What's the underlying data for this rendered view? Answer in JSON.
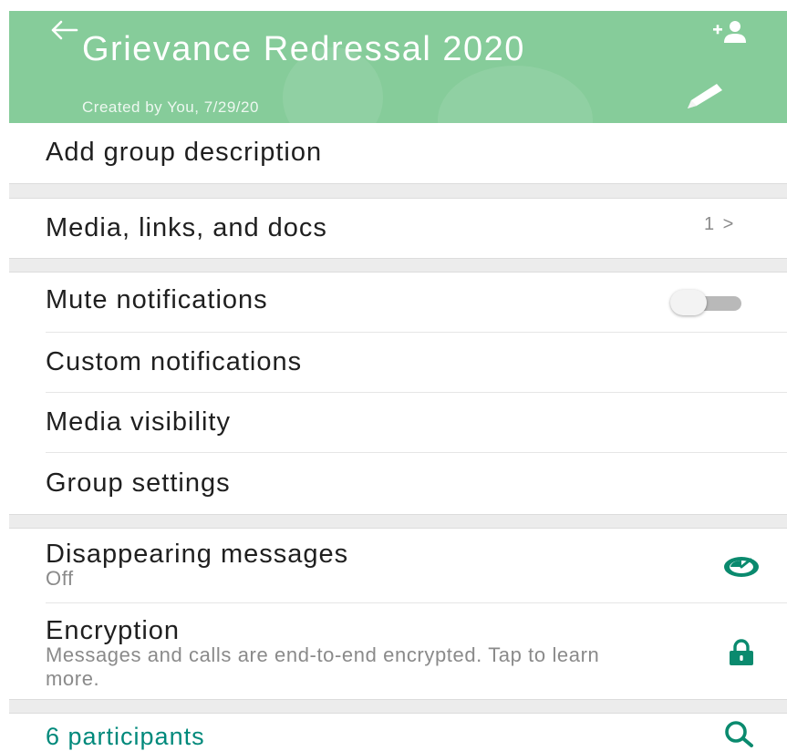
{
  "header": {
    "title": "Grievance Redressal 2020",
    "created_by": "Created by You, 7/29/20",
    "background_color": "#86cc9a",
    "icons": {
      "back": "back-arrow-icon",
      "add_participant": "add-participant-icon",
      "edit": "pencil-icon"
    }
  },
  "rows": {
    "description": {
      "label": "Add group description"
    },
    "media": {
      "label": "Media, links, and docs",
      "count": "1 >"
    },
    "mute": {
      "label": "Mute notifications",
      "toggle_on": false
    },
    "custom_notifications": {
      "label": "Custom notifications"
    },
    "media_visibility": {
      "label": "Media visibility"
    },
    "group_settings": {
      "label": "Group settings"
    },
    "disappearing": {
      "label": "Disappearing messages",
      "value": "Off",
      "icon": "timer-icon"
    },
    "encryption": {
      "label": "Encryption",
      "subtitle": "Messages and calls are end-to-end encrypted. Tap to learn more.",
      "icon": "lock-icon"
    }
  },
  "participants": {
    "label": "6 participants",
    "icon": "search-icon"
  },
  "colors": {
    "accent": "#00897b",
    "icon_teal": "#0a8a6e"
  }
}
